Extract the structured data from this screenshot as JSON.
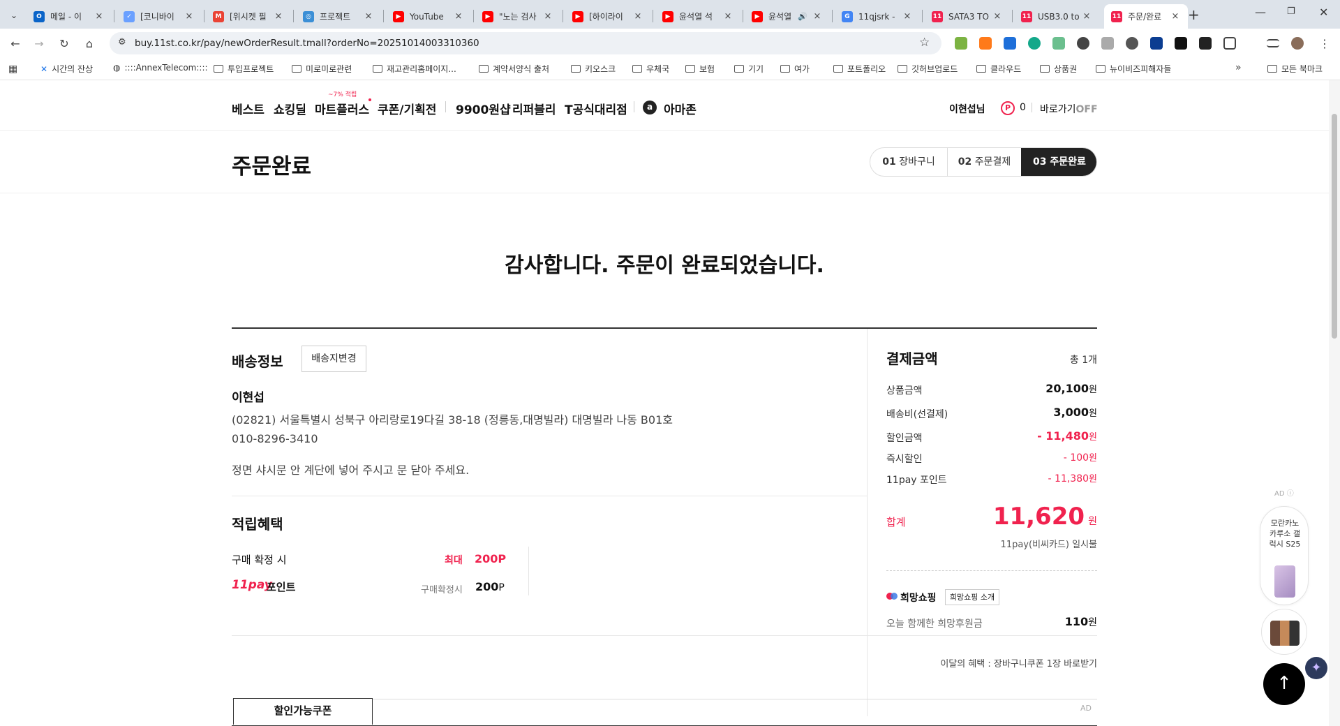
{
  "browser": {
    "tabs": [
      {
        "title": "메일 - 이",
        "fav": "#0a64c8",
        "glyph": "O"
      },
      {
        "title": "[코니바이",
        "fav": "#6aa0ff",
        "glyph": "✓"
      },
      {
        "title": "[위시켓 필",
        "fav": "#ea4335",
        "glyph": "M"
      },
      {
        "title": "프로젝트",
        "fav": "#3b8fd6",
        "glyph": "◎"
      },
      {
        "title": "YouTube",
        "fav": "#ff0000",
        "glyph": "▶"
      },
      {
        "title": "\"노는 검사",
        "fav": "#ff0000",
        "glyph": "▶"
      },
      {
        "title": "[하이라이",
        "fav": "#ff0000",
        "glyph": "▶"
      },
      {
        "title": "윤석열 석",
        "fav": "#ff0000",
        "glyph": "▶"
      },
      {
        "title": "윤석열",
        "fav": "#ff0000",
        "glyph": "▶"
      },
      {
        "title": "11qjsrk -",
        "fav": "#4285f4",
        "glyph": "G"
      },
      {
        "title": "SATA3 TO",
        "fav": "#f0224e",
        "glyph": "11"
      },
      {
        "title": "USB3.0 to",
        "fav": "#f0224e",
        "glyph": "11"
      },
      {
        "title": "주문/완료",
        "fav": "#f0224e",
        "glyph": "11"
      }
    ],
    "url": "buy.11st.co.kr/pay/newOrderResult.tmall?orderNo=20251014003310360",
    "bookmarks": [
      "시간의 잔상",
      "::::AnnexTelecom::::",
      "투입프로젝트",
      "미로미로관련",
      "재고관리홈페이지...",
      "계약서양식 출처",
      "키오스크",
      "우체국",
      "보험",
      "기기",
      "여가",
      "포트폴리오",
      "깃허브업로드",
      "클라우드",
      "상품권",
      "뉴이비즈피해자들"
    ],
    "all_bookmarks": "모든 북마크"
  },
  "gnb": {
    "items": [
      "베스트",
      "쇼킹딜",
      "마트플러스",
      "쿠폰/기획전",
      "9900원샵",
      "리퍼블리",
      "T공식대리점",
      "아마존"
    ],
    "mart_badge": "~7% 적립",
    "user_name": "이현섭님",
    "points": "0",
    "quick_label": "바로가기",
    "quick_state": "OFF"
  },
  "title": "주문완료",
  "steps": [
    {
      "num": "01",
      "label": "장바구니"
    },
    {
      "num": "02",
      "label": "주문결제"
    },
    {
      "num": "03",
      "label": "주문완료"
    }
  ],
  "thanks": "감사합니다. 주문이 완료되었습니다.",
  "delivery": {
    "title": "배송정보",
    "change_btn": "배송지변경",
    "name": "이현섭",
    "address": "(02821) 서울특별시 성북구 아리랑로19다길 38-18 (정릉동,대명빌라) 대명빌라 나동 B01호",
    "phone": "010-8296-3410",
    "memo": "정면 샤시문 안 계단에 넣어 주시고 문 닫아 주세요."
  },
  "rewards": {
    "title": "적립혜택",
    "row1_label": "구매 확정 시",
    "row1_prefix": "최대",
    "row1_value": "200P",
    "row2_label": "포인트",
    "row2_sub": "구매확정시",
    "row2_value": "200",
    "row2_unit": "P"
  },
  "payment": {
    "title": "결제금액",
    "count": "총 1개",
    "rows": [
      {
        "label": "상품금액",
        "value": "20,100",
        "unit": "원"
      },
      {
        "label": "배송비(선결제)",
        "value": "3,000",
        "unit": "원"
      },
      {
        "label": "할인금액",
        "value": "- 11,480",
        "unit": "원"
      },
      {
        "label": "즉시할인",
        "value": "- 100",
        "unit": "원"
      },
      {
        "label": "11pay 포인트",
        "value": "- 11,380",
        "unit": "원"
      }
    ],
    "total_label": "합계",
    "total_value": "11,620",
    "total_unit": "원",
    "method": "11pay(비씨카드) 일시불",
    "hope_title": "희망쇼핑",
    "hope_btn": "희망쇼핑 소개",
    "hope_label": "오늘 함께한 희망후원금",
    "hope_value": "110",
    "hope_unit": "원"
  },
  "monthly_benefit": "이달의 혜택 : 장바구니쿠폰 1장 바로받기",
  "coupon_tab": "할인가능쿠폰",
  "ad_label": "AD",
  "side_ad": {
    "label": "AD",
    "product": "모란카노 카루소 갤럭시 S25"
  }
}
